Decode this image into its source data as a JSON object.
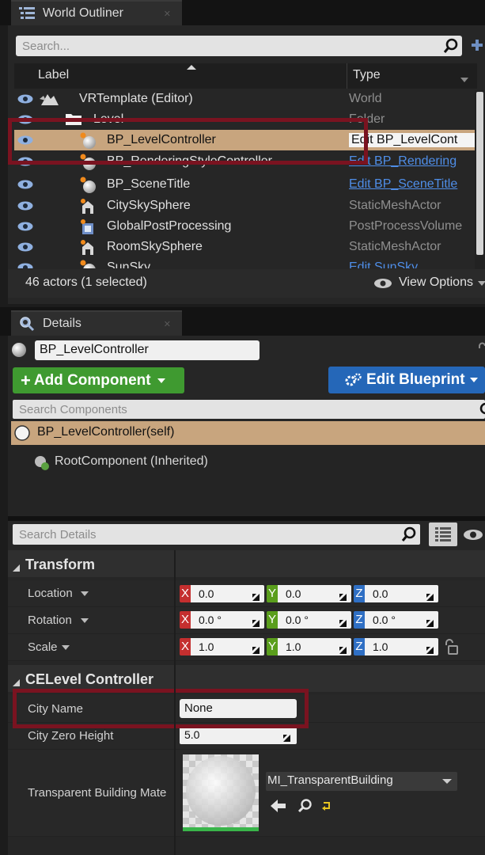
{
  "outliner": {
    "tab_label": "World Outliner",
    "search_placeholder": "Search...",
    "col_label": "Label",
    "col_type": "Type",
    "rows": [
      {
        "label": "VRTemplate (Editor)",
        "type": "World",
        "type_link": false,
        "icon": "world-icon"
      },
      {
        "label": "Level",
        "type": "Folder",
        "type_link": false,
        "icon": "folder-icon"
      },
      {
        "label": "BP_LevelController",
        "type": "Edit BP_LevelCont",
        "type_link": true,
        "icon": "blueprint-sphere-icon",
        "selected": true
      },
      {
        "label": "BP_RenderingStyleController",
        "type": "Edit BP_Rendering",
        "type_link": true,
        "icon": "blueprint-sphere-icon"
      },
      {
        "label": "BP_SceneTitle",
        "type": "Edit BP_SceneTitle",
        "type_link": true,
        "icon": "blueprint-sphere-icon"
      },
      {
        "label": "CitySkySphere",
        "type": "StaticMeshActor",
        "type_link": false,
        "icon": "static-mesh-icon"
      },
      {
        "label": "GlobalPostProcessing",
        "type": "PostProcessVolume",
        "type_link": false,
        "icon": "post-process-icon"
      },
      {
        "label": "RoomSkySphere",
        "type": "StaticMeshActor",
        "type_link": false,
        "icon": "static-mesh-icon"
      },
      {
        "label": "SunSky",
        "type": "Edit SunSky",
        "type_link": true,
        "icon": "blueprint-sphere-icon"
      }
    ],
    "status": "46 actors (1 selected)",
    "view_options": "View Options"
  },
  "details": {
    "tab_label": "Details",
    "actor_name": "BP_LevelController",
    "add_component": "Add Component",
    "edit_blueprint": "Edit Blueprint",
    "search_components_placeholder": "Search Components",
    "self_component": "BP_LevelController(self)",
    "root_component": "RootComponent (Inherited)",
    "search_details_placeholder": "Search Details",
    "transform": {
      "title": "Transform",
      "location": {
        "label": "Location",
        "x": "0.0",
        "y": "0.0",
        "z": "0.0"
      },
      "rotation": {
        "label": "Rotation",
        "x": "0.0 °",
        "y": "0.0 °",
        "z": "0.0 °"
      },
      "scale": {
        "label": "Scale",
        "x": "1.0",
        "y": "1.0",
        "z": "1.0"
      }
    },
    "celevel": {
      "title": "CELevel Controller",
      "city_name_label": "City Name",
      "city_name_value": "None",
      "city_zero_label": "City Zero Height",
      "city_zero_value": "5.0",
      "material_label": "Transparent Building Mate",
      "material_value": "MI_TransparentBuilding"
    }
  },
  "colors": {
    "selection": "#c8a57e",
    "highlight_box": "#7a1320",
    "add_component": "#3f9a30",
    "edit_blueprint": "#2567b8",
    "link": "#4f8ee8"
  }
}
